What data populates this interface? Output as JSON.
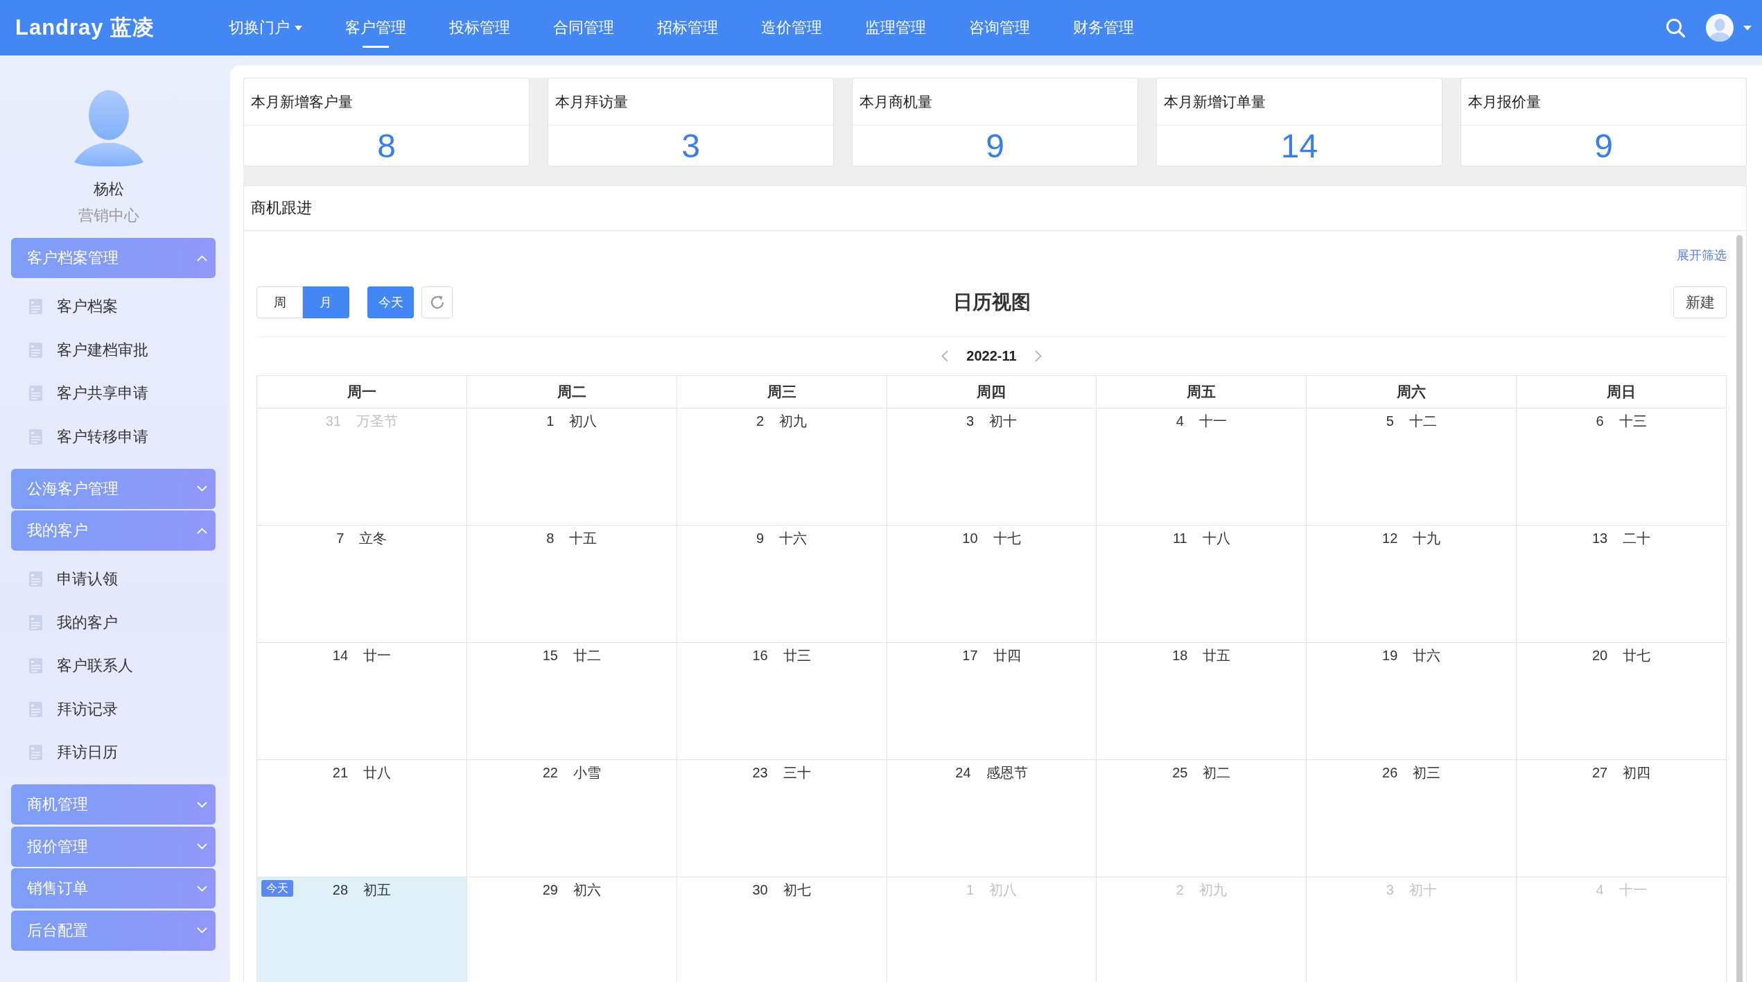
{
  "top_bar": {
    "logo": "Landray 蓝凌",
    "nav": [
      {
        "label": "切换门户",
        "kind": "dropdown",
        "selected": false
      },
      {
        "label": "客户管理",
        "kind": "link",
        "selected": true
      },
      {
        "label": "投标管理",
        "kind": "link",
        "selected": false
      },
      {
        "label": "合同管理",
        "kind": "link",
        "selected": false
      },
      {
        "label": "招标管理",
        "kind": "link",
        "selected": false
      },
      {
        "label": "造价管理",
        "kind": "link",
        "selected": false
      },
      {
        "label": "监理管理",
        "kind": "link",
        "selected": false
      },
      {
        "label": "咨询管理",
        "kind": "link",
        "selected": false
      },
      {
        "label": "财务管理",
        "kind": "link",
        "selected": false
      }
    ]
  },
  "sidebar": {
    "user": {
      "name": "杨松",
      "department": "营销中心"
    },
    "groups": [
      {
        "title": "客户档案管理",
        "expanded": true,
        "items": [
          "客户档案",
          "客户建档审批",
          "客户共享申请",
          "客户转移申请"
        ]
      },
      {
        "title": "公海客户管理",
        "expanded": false
      },
      {
        "title": "我的客户",
        "expanded": true,
        "items": [
          "申请认领",
          "我的客户",
          "客户联系人",
          "拜访记录",
          "拜访日历"
        ]
      },
      {
        "title": "商机管理",
        "expanded": false
      },
      {
        "title": "报价管理",
        "expanded": false
      },
      {
        "title": "销售订单",
        "expanded": false
      },
      {
        "title": "后台配置",
        "expanded": false
      }
    ]
  },
  "stats": [
    {
      "label": "本月新增客户量",
      "value": "8"
    },
    {
      "label": "本月拜访量",
      "value": "3"
    },
    {
      "label": "本月商机量",
      "value": "9"
    },
    {
      "label": "本月新增订单量",
      "value": "14"
    },
    {
      "label": "本月报价量",
      "value": "9"
    }
  ],
  "opportunity_panel": {
    "title": "商机跟进",
    "filter_link": "展开筛选",
    "calendar": {
      "view_switch": [
        {
          "label": "周",
          "selected": false
        },
        {
          "label": "月",
          "selected": true
        }
      ],
      "today_button": "今天",
      "title": "日历视图",
      "new_button": "新建",
      "month": "2022-11",
      "weekdays": [
        "周一",
        "周二",
        "周三",
        "周四",
        "周五",
        "周六",
        "周日"
      ],
      "today_badge": "今天",
      "weeks": [
        {
          "days": [
            {
              "day": "31",
              "lunar": "万圣节",
              "in_month": false,
              "today": false
            },
            {
              "day": "1",
              "lunar": "初八",
              "in_month": true,
              "today": false
            },
            {
              "day": "2",
              "lunar": "初九",
              "in_month": true,
              "today": false
            },
            {
              "day": "3",
              "lunar": "初十",
              "in_month": true,
              "today": false
            },
            {
              "day": "4",
              "lunar": "十一",
              "in_month": true,
              "today": false
            },
            {
              "day": "5",
              "lunar": "十二",
              "in_month": true,
              "today": false
            },
            {
              "day": "6",
              "lunar": "十三",
              "in_month": true,
              "today": false
            }
          ]
        },
        {
          "days": [
            {
              "day": "7",
              "lunar": "立冬",
              "in_month": true,
              "today": false
            },
            {
              "day": "8",
              "lunar": "十五",
              "in_month": true,
              "today": false
            },
            {
              "day": "9",
              "lunar": "十六",
              "in_month": true,
              "today": false
            },
            {
              "day": "10",
              "lunar": "十七",
              "in_month": true,
              "today": false
            },
            {
              "day": "11",
              "lunar": "十八",
              "in_month": true,
              "today": false
            },
            {
              "day": "12",
              "lunar": "十九",
              "in_month": true,
              "today": false
            },
            {
              "day": "13",
              "lunar": "二十",
              "in_month": true,
              "today": false
            }
          ]
        },
        {
          "days": [
            {
              "day": "14",
              "lunar": "廿一",
              "in_month": true,
              "today": false
            },
            {
              "day": "15",
              "lunar": "廿二",
              "in_month": true,
              "today": false
            },
            {
              "day": "16",
              "lunar": "廿三",
              "in_month": true,
              "today": false
            },
            {
              "day": "17",
              "lunar": "廿四",
              "in_month": true,
              "today": false
            },
            {
              "day": "18",
              "lunar": "廿五",
              "in_month": true,
              "today": false
            },
            {
              "day": "19",
              "lunar": "廿六",
              "in_month": true,
              "today": false
            },
            {
              "day": "20",
              "lunar": "廿七",
              "in_month": true,
              "today": false
            }
          ]
        },
        {
          "days": [
            {
              "day": "21",
              "lunar": "廿八",
              "in_month": true,
              "today": false
            },
            {
              "day": "22",
              "lunar": "小雪",
              "in_month": true,
              "today": false
            },
            {
              "day": "23",
              "lunar": "三十",
              "in_month": true,
              "today": false
            },
            {
              "day": "24",
              "lunar": "感恩节",
              "in_month": true,
              "today": false
            },
            {
              "day": "25",
              "lunar": "初二",
              "in_month": true,
              "today": false
            },
            {
              "day": "26",
              "lunar": "初三",
              "in_month": true,
              "today": false
            },
            {
              "day": "27",
              "lunar": "初四",
              "in_month": true,
              "today": false
            }
          ]
        },
        {
          "days": [
            {
              "day": "28",
              "lunar": "初五",
              "in_month": true,
              "today": true
            },
            {
              "day": "29",
              "lunar": "初六",
              "in_month": true,
              "today": false
            },
            {
              "day": "30",
              "lunar": "初七",
              "in_month": true,
              "today": false
            },
            {
              "day": "1",
              "lunar": "初八",
              "in_month": false,
              "today": false
            },
            {
              "day": "2",
              "lunar": "初九",
              "in_month": false,
              "today": false
            },
            {
              "day": "3",
              "lunar": "初十",
              "in_month": false,
              "today": false
            },
            {
              "day": "4",
              "lunar": "十一",
              "in_month": false,
              "today": false
            }
          ]
        }
      ]
    }
  }
}
